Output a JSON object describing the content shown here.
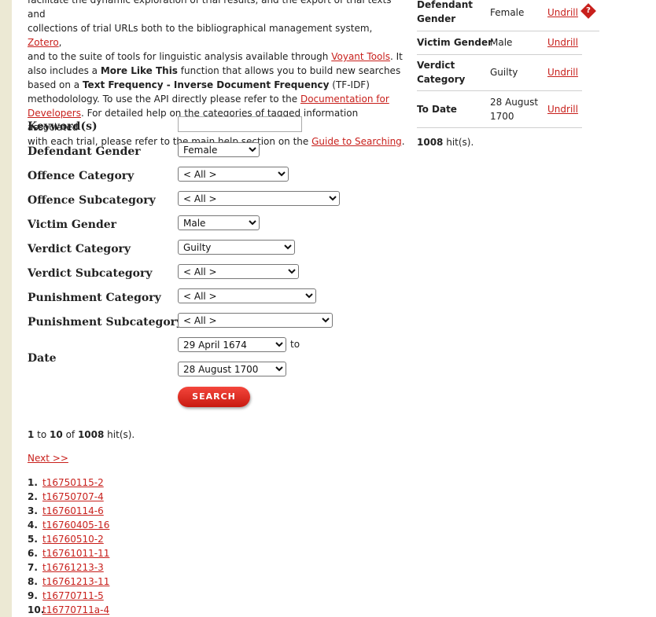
{
  "intro": {
    "line1": "facilitate the dynamic exploration of trial results, and the export of trial texts and",
    "line2a": "collections of trial URLs both to the bibliographical management system, ",
    "zotero": "Zotero",
    "line2b": ",",
    "line3a": "and to the suite of tools for linguistic analysis available through ",
    "voyant": "Voyant Tools",
    "line3b": ". It",
    "line4a": "also includes a ",
    "more_like_this": "More Like This",
    "line4b": " function that allows you to build new searches",
    "line5a": "based on a ",
    "tfidf": "Text Frequency - Inverse Document Frequency",
    "line5b": " (TF-IDF)",
    "line6a": "methodolology. To use the API directly please refer to the ",
    "docs1": "Documentation for",
    "docs2": "Developers",
    "line7b": ". For detailed help on the categories of tagged information associated",
    "line8a": "with each trial, please refer to the main help section on the ",
    "guide": "Guide to Searching",
    "line8b": "."
  },
  "form": {
    "keyword_label": "Keyword(s)",
    "keyword_value": "",
    "defendant_gender_label": "Defendant Gender",
    "defendant_gender_value": "Female",
    "offence_category_label": "Offence Category",
    "offence_category_value": "< All >",
    "offence_subcategory_label": "Offence Subcategory",
    "offence_subcategory_value": "< All >",
    "victim_gender_label": "Victim Gender",
    "victim_gender_value": "Male",
    "verdict_category_label": "Verdict Category",
    "verdict_category_value": "Guilty",
    "verdict_subcategory_label": "Verdict Subcategory",
    "verdict_subcategory_value": "< All >",
    "punishment_category_label": "Punishment Category",
    "punishment_category_value": "< All >",
    "punishment_subcategory_label": "Punishment Subcategory",
    "punishment_subcategory_value": "< All >",
    "date_label": "Date",
    "date_from": "29 April 1674",
    "date_to_word": "to",
    "date_to": "28 August 1700",
    "search_label": "SEARCH"
  },
  "results": {
    "range_start": "1",
    "to_word": " to ",
    "range_end": "10",
    "of_word": " of ",
    "total": "1008",
    "hits_suffix": " hit(s).",
    "next_label": "Next >>",
    "items": [
      {
        "num": "1.",
        "id": "t16750115-2"
      },
      {
        "num": "2.",
        "id": "t16750707-4"
      },
      {
        "num": "3.",
        "id": "t16760114-6"
      },
      {
        "num": "4.",
        "id": "t16760405-16"
      },
      {
        "num": "5.",
        "id": "t16760510-2"
      },
      {
        "num": "6.",
        "id": "t16761011-11"
      },
      {
        "num": "7.",
        "id": "t16761213-3"
      },
      {
        "num": "8.",
        "id": "t16761213-11"
      },
      {
        "num": "9.",
        "id": "t16770711-5"
      },
      {
        "num": "10.",
        "id": "t16770711a-4"
      }
    ]
  },
  "summary": {
    "rows": [
      {
        "label1": "Defendant",
        "label2": "Gender",
        "value": "Female",
        "undrill": "Undrill"
      },
      {
        "label1": "Victim Gender",
        "label2": "",
        "value": "Male",
        "undrill": "Undrill"
      },
      {
        "label1": "Verdict",
        "label2": "Category",
        "value": "Guilty",
        "undrill": "Undrill"
      },
      {
        "label1": "To Date",
        "label2": "",
        "value1": "28 August",
        "value2": "1700",
        "undrill": "Undrill"
      }
    ],
    "help_glyph": "?",
    "hits_count": "1008",
    "hits_suffix": " hit(s)."
  },
  "colors": {
    "link": "#c8201c",
    "stripe": "#ece9d4",
    "button": "#d8241a"
  }
}
